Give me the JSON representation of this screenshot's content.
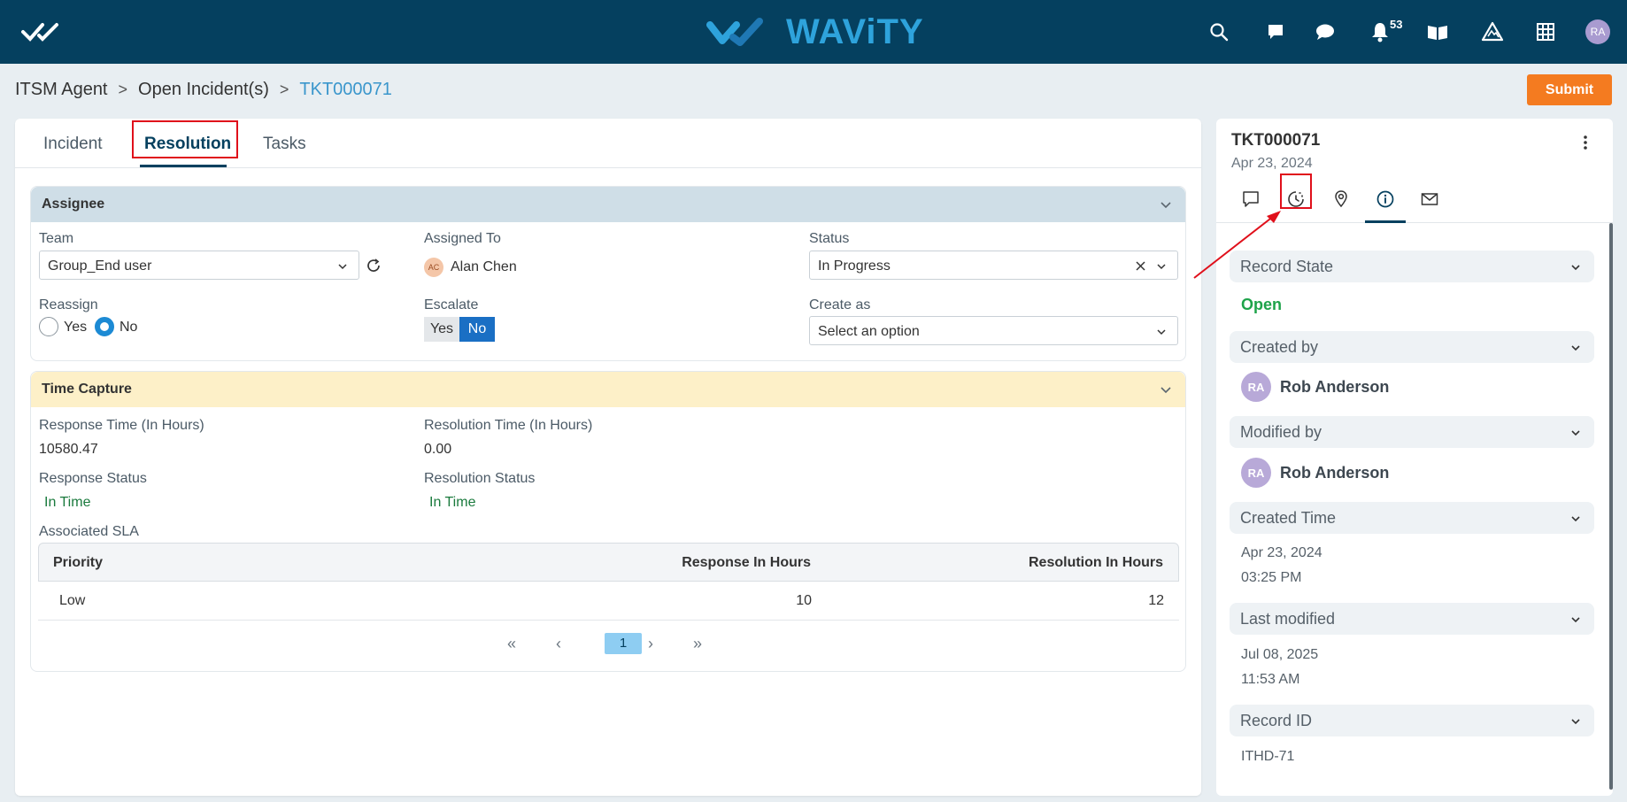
{
  "topbar": {
    "brand": "WAViTY",
    "notification_count": "53",
    "user_initials": "RA",
    "icons": [
      "search-icon",
      "chat-icon",
      "message-icon",
      "bell-icon",
      "book-icon",
      "mountain-icon",
      "grid-icon"
    ]
  },
  "breadcrumb": {
    "items": [
      "ITSM Agent",
      "Open Incident(s)"
    ],
    "current": "TKT000071",
    "separator": ">"
  },
  "submit_label": "Submit",
  "tabs": [
    "Incident",
    "Resolution",
    "Tasks"
  ],
  "active_tab": "Resolution",
  "assignee": {
    "title": "Assignee",
    "team_label": "Team",
    "team_value": "Group_End user",
    "assigned_to_label": "Assigned To",
    "assigned_to_initials": "AC",
    "assigned_to_name": "Alan Chen",
    "status_label": "Status",
    "status_value": "In Progress",
    "reassign_label": "Reassign",
    "reassign_options": [
      "Yes",
      "No"
    ],
    "reassign_selected": "No",
    "escalate_label": "Escalate",
    "escalate_options": [
      "Yes",
      "No"
    ],
    "escalate_selected": "No",
    "create_as_label": "Create as",
    "create_as_placeholder": "Select an option"
  },
  "time_capture": {
    "title": "Time Capture",
    "response_time_label": "Response Time (In Hours)",
    "response_time_value": "10580.47",
    "resolution_time_label": "Resolution Time (In Hours)",
    "resolution_time_value": "0.00",
    "response_status_label": "Response Status",
    "response_status_value": "In Time",
    "resolution_status_label": "Resolution Status",
    "resolution_status_value": "In Time",
    "sla_label": "Associated SLA",
    "sla_columns": [
      "Priority",
      "Response In Hours",
      "Resolution In Hours"
    ],
    "sla_rows": [
      [
        "Low",
        "10",
        "12"
      ]
    ],
    "pager": {
      "first": "«",
      "prev": "‹",
      "current": "1",
      "next": "›",
      "last": "»"
    }
  },
  "side": {
    "ticket_id": "TKT000071",
    "date": "Apr 23, 2024",
    "tab_icons": [
      "comment-icon",
      "sla-timer-icon",
      "location-icon",
      "info-icon",
      "mail-icon"
    ],
    "active_tab": "info-icon",
    "record_state_label": "Record State",
    "record_state_value": "Open",
    "created_by_label": "Created by",
    "created_by_initials": "RA",
    "created_by_name": "Rob Anderson",
    "modified_by_label": "Modified by",
    "modified_by_initials": "RA",
    "modified_by_name": "Rob Anderson",
    "created_time_label": "Created Time",
    "created_time_date": "Apr 23, 2024",
    "created_time_time": "03:25 PM",
    "last_modified_label": "Last modified",
    "last_modified_date": "Jul 08, 2025",
    "last_modified_time": "11:53 AM",
    "record_id_label": "Record ID",
    "record_id_value": "ITHD-71"
  },
  "colors": {
    "nav_bg": "#05405f",
    "brand_blue": "#2ea3dc",
    "submit_orange": "#f47b20",
    "assignee_header": "#cfdee7",
    "time_capture_header": "#fdf0c8",
    "status_green": "#1a7a3d",
    "open_green": "#1ea34a",
    "annotation_red": "#e0101b"
  }
}
